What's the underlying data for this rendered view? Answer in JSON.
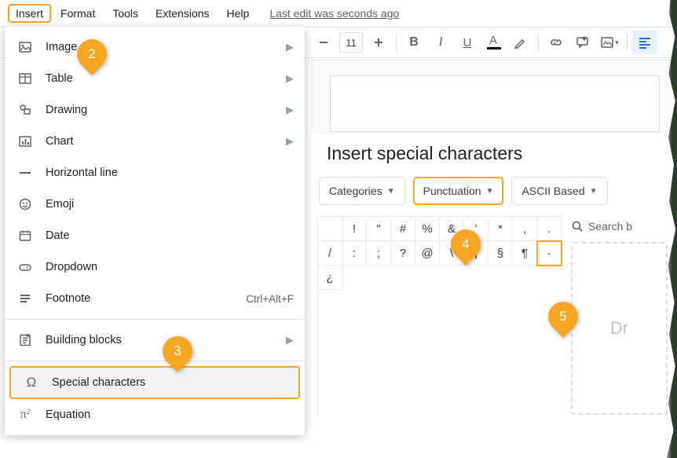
{
  "menubar": {
    "items": [
      "Insert",
      "Format",
      "Tools",
      "Extensions",
      "Help"
    ],
    "last_edit": "Last edit was seconds ago"
  },
  "toolbar": {
    "font_size": "11"
  },
  "insert_menu": {
    "items": [
      {
        "icon": "image-icon",
        "label": "Image",
        "submenu": true
      },
      {
        "icon": "table-icon",
        "label": "Table",
        "submenu": true
      },
      {
        "icon": "drawing-icon",
        "label": "Drawing",
        "submenu": true
      },
      {
        "icon": "chart-icon",
        "label": "Chart",
        "submenu": true
      },
      {
        "icon": "hr-icon",
        "label": "Horizontal line",
        "submenu": false
      },
      {
        "icon": "emoji-icon",
        "label": "Emoji",
        "submenu": false
      },
      {
        "icon": "date-icon",
        "label": "Date",
        "submenu": false
      },
      {
        "icon": "dropdown-icon",
        "label": "Dropdown",
        "submenu": false
      },
      {
        "icon": "footnote-icon",
        "label": "Footnote",
        "submenu": false,
        "shortcut": "Ctrl+Alt+F"
      },
      {
        "divider": true
      },
      {
        "icon": "blocks-icon",
        "label": "Building blocks",
        "submenu": true
      },
      {
        "divider": true
      },
      {
        "icon": "omega-icon",
        "label": "Special characters",
        "submenu": false,
        "highlight": true
      },
      {
        "icon": "pi-icon",
        "label": "Equation",
        "submenu": false
      }
    ]
  },
  "special_chars": {
    "title": "Insert special characters",
    "filters": {
      "categories": "Categories",
      "punctuation": "Punctuation",
      "ascii": "ASCII Based"
    },
    "search_placeholder": "Search b",
    "draw_placeholder": "Dr",
    "grid": [
      [
        "",
        "!",
        "\"",
        "#",
        "%",
        "&",
        "'",
        "*",
        ",",
        "."
      ],
      [
        "/",
        ":",
        ";",
        "?",
        "@",
        "\\",
        "¡",
        "§",
        "¶",
        "·"
      ],
      [
        "¿",
        "",
        "",
        "",
        "",
        "",
        "",
        "",
        "",
        ""
      ]
    ],
    "selected": {
      "row": 1,
      "col": 9
    }
  },
  "callouts": {
    "c2": "2",
    "c3": "3",
    "c4": "4",
    "c5": "5"
  }
}
